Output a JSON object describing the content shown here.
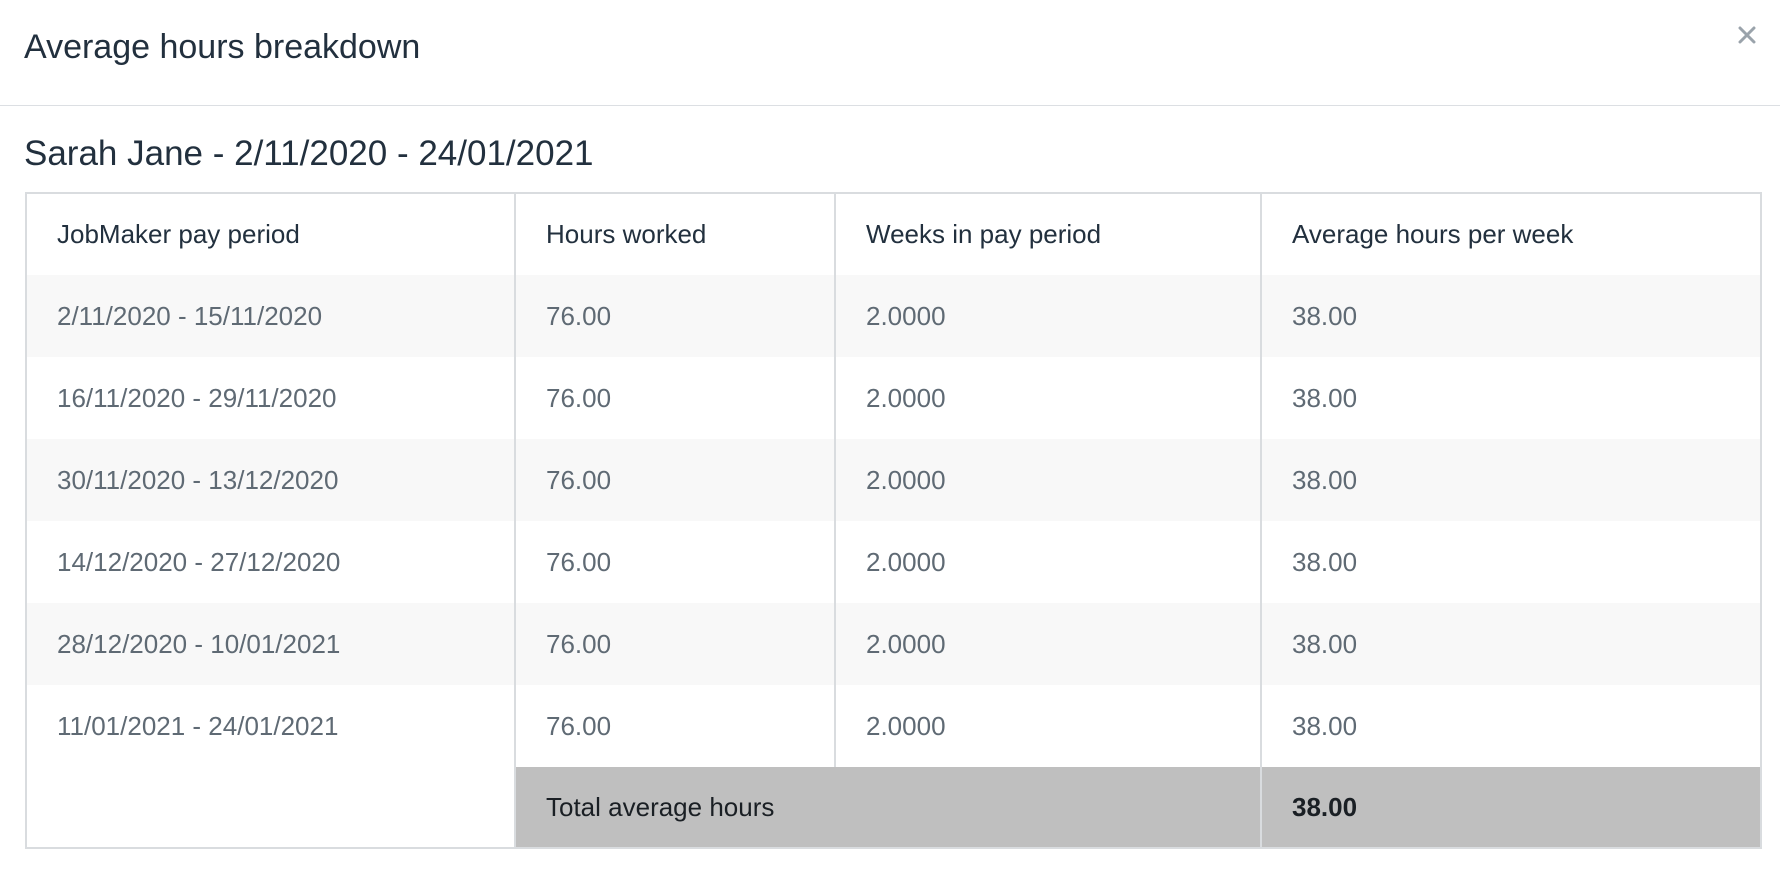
{
  "modal": {
    "title": "Average hours breakdown",
    "close_icon": "close-icon"
  },
  "subtitle": "Sarah Jane - 2/11/2020 - 24/01/2021",
  "table": {
    "headers": [
      "JobMaker pay period",
      "Hours worked",
      "Weeks in pay period",
      "Average hours per week"
    ],
    "rows": [
      [
        "2/11/2020 - 15/11/2020",
        "76.00",
        "2.0000",
        "38.00"
      ],
      [
        "16/11/2020 - 29/11/2020",
        "76.00",
        "2.0000",
        "38.00"
      ],
      [
        "30/11/2020 - 13/12/2020",
        "76.00",
        "2.0000",
        "38.00"
      ],
      [
        "14/12/2020 - 27/12/2020",
        "76.00",
        "2.0000",
        "38.00"
      ],
      [
        "28/12/2020 - 10/01/2021",
        "76.00",
        "2.0000",
        "38.00"
      ],
      [
        "11/01/2021 - 24/01/2021",
        "76.00",
        "2.0000",
        "38.00"
      ]
    ],
    "footer": {
      "label": "Total average hours",
      "value": "38.00"
    }
  },
  "colors": {
    "title_text": "#22303e",
    "body_text": "#5f6a74",
    "striped_row": "#f8f8f8",
    "footer_bg": "#bfbfbf",
    "border": "#d9dcdf"
  }
}
